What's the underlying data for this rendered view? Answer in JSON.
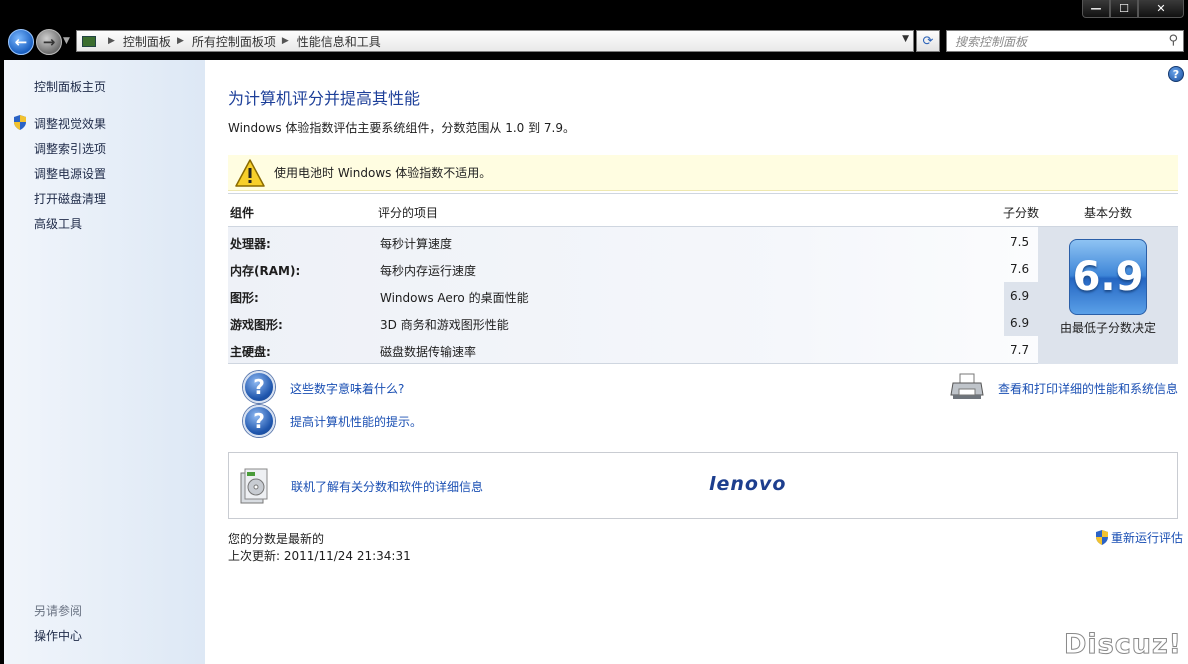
{
  "window": {
    "minimize_label": "—",
    "maximize_label": "☐",
    "close_label": "✕"
  },
  "address_bar": {
    "crumbs": [
      "控制面板",
      "所有控制面板项",
      "性能信息和工具"
    ],
    "search_placeholder": "搜索控制面板"
  },
  "sidebar": {
    "home": "控制面板主页",
    "items": [
      {
        "label": "调整视觉效果",
        "shield": true
      },
      {
        "label": "调整索引选项",
        "shield": false
      },
      {
        "label": "调整电源设置",
        "shield": false
      },
      {
        "label": "打开磁盘清理",
        "shield": false
      },
      {
        "label": "高级工具",
        "shield": false
      }
    ],
    "see_also_heading": "另请参阅",
    "see_also_items": [
      "操作中心"
    ]
  },
  "main": {
    "title": "为计算机评分并提高其性能",
    "description": "Windows 体验指数评估主要系统组件，分数范围从 1.0 到 7.9。",
    "warning": "使用电池时 Windows 体验指数不适用。",
    "table": {
      "headers": {
        "component": "组件",
        "rated_item": "评分的项目",
        "subscore": "子分数",
        "base_score": "基本分数"
      },
      "rows": [
        {
          "component": "处理器:",
          "item": "每秒计算速度",
          "subscore": "7.5"
        },
        {
          "component": "内存(RAM):",
          "item": "每秒内存运行速度",
          "subscore": "7.6"
        },
        {
          "component": "图形:",
          "item": "Windows Aero 的桌面性能",
          "subscore": "6.9"
        },
        {
          "component": "游戏图形:",
          "item": "3D 商务和游戏图形性能",
          "subscore": "6.9"
        },
        {
          "component": "主硬盘:",
          "item": "磁盘数据传输速率",
          "subscore": "7.7"
        }
      ],
      "base_score": "6.9",
      "base_score_note": "由最低子分数决定"
    },
    "links": {
      "what_numbers_mean": "这些数字意味着什么?",
      "tips": "提高计算机性能的提示。",
      "print_details": "查看和打印详细的性能和系统信息"
    },
    "info_box": {
      "link": "联机了解有关分数和软件的详细信息",
      "oem_logo": "lenovo"
    },
    "status": "您的分数是最新的",
    "last_updated": "上次更新: 2011/11/24 21:34:31",
    "rerun": "重新运行评估"
  },
  "watermark": "Discuz!"
}
